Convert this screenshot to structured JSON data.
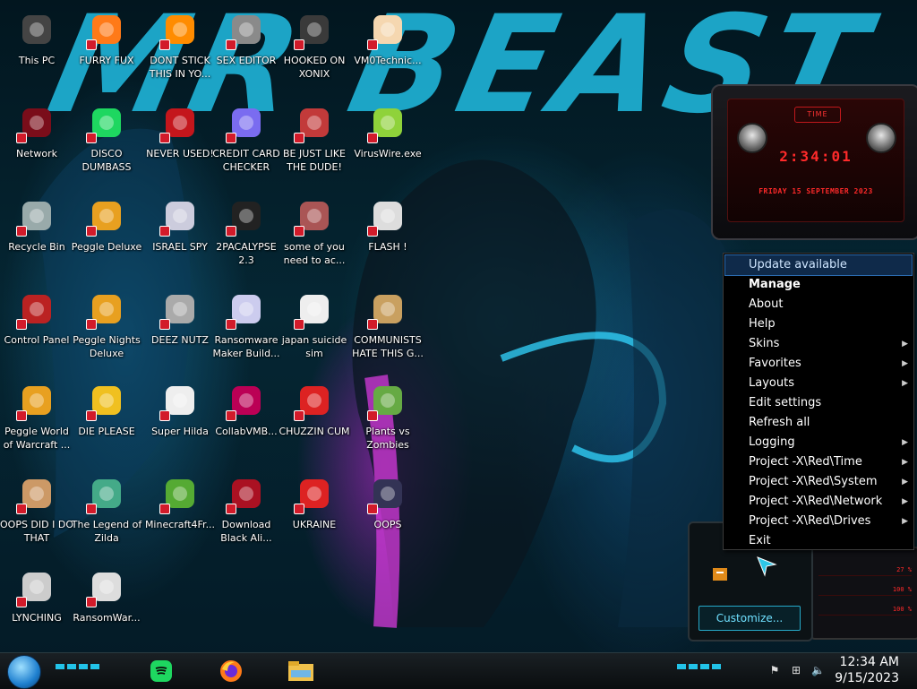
{
  "wallpaper": {
    "title": "MR BEAST"
  },
  "desktop": {
    "icons": [
      {
        "label": "This PC",
        "icon": "this-pc-icon"
      },
      {
        "label": "FURRY FUX",
        "icon": "firefox-icon"
      },
      {
        "label": "DONT STICK THIS IN YO...",
        "icon": "vlc-cone-icon"
      },
      {
        "label": "SEX EDITOR",
        "icon": "hex-editor-icon"
      },
      {
        "label": "HOOKED ON XONIX",
        "icon": "xonix-game-icon"
      },
      {
        "label": "VM0Technic...",
        "icon": "doctor-avatar-icon"
      },
      {
        "label": "Network",
        "icon": "network-icon"
      },
      {
        "label": "DISCO DUMBASS",
        "icon": "spotify-icon"
      },
      {
        "label": "NEVER USED!",
        "icon": "dev-cpp-icon"
      },
      {
        "label": "CREDIT CARD CHECKER",
        "icon": "credit-card-icon"
      },
      {
        "label": "BE JUST LIKE THE DUDE!",
        "icon": "santa-icon"
      },
      {
        "label": "VirusWire.exe",
        "icon": "lime-icon"
      },
      {
        "label": "Recycle Bin",
        "icon": "recycle-bin-icon"
      },
      {
        "label": "Peggle Deluxe",
        "icon": "peggle-icon"
      },
      {
        "label": "ISRAEL SPY",
        "icon": "spy-app-icon"
      },
      {
        "label": "2PACALYPSE 2.3",
        "icon": "terminal-icon"
      },
      {
        "label": "some of you need to ac...",
        "icon": "beaver-icon"
      },
      {
        "label": "FLASH !",
        "icon": "flash-document-icon"
      },
      {
        "label": "Control Panel",
        "icon": "control-panel-icon"
      },
      {
        "label": "Peggle Nights Deluxe",
        "icon": "peggle-nights-icon"
      },
      {
        "label": "DEEZ NUTZ",
        "icon": "window-stack-icon"
      },
      {
        "label": "Ransomware Maker Build...",
        "icon": "program-window-icon"
      },
      {
        "label": "japan suicide sim",
        "icon": "document-chart-icon"
      },
      {
        "label": "COMMUNISTS HATE THIS G...",
        "icon": "money-bag-icon"
      },
      {
        "label": "Peggle World of Warcraft ...",
        "icon": "peggle-wow-icon"
      },
      {
        "label": "DIE PLEASE",
        "icon": "adobe-de-icon"
      },
      {
        "label": "Super Hilda",
        "icon": "pixel-game-icon"
      },
      {
        "label": "CollabVMB...",
        "icon": "collabvm-icon"
      },
      {
        "label": "CHUZZIN CUM",
        "icon": "chuzzle-icon"
      },
      {
        "label": "Plants vs Zombies",
        "icon": "plants-vs-zombies-icon"
      },
      {
        "label": "OOPS DID I DO THAT",
        "icon": "portrait-icon"
      },
      {
        "label": "The Legend of Zilda",
        "icon": "zelda-sprite-icon"
      },
      {
        "label": "Minecraft4Fr...",
        "icon": "minecraft-block-icon"
      },
      {
        "label": "Download Black Ali...",
        "icon": "alienware-orb-icon"
      },
      {
        "label": "UKRAINE",
        "icon": "radiation-icon"
      },
      {
        "label": "OOPS",
        "icon": "oops-icon"
      },
      {
        "label": "LYNCHING",
        "icon": "network-cube-icon"
      },
      {
        "label": "RansomWar...",
        "icon": "skull-icon"
      }
    ]
  },
  "widgets": {
    "clock": {
      "title": "TIME",
      "time": "2:34:01",
      "date": "FRIDAY 15 SEPTEMBER 2023"
    },
    "drives": {
      "values": [
        "27 %",
        "100 %",
        "100 %"
      ]
    },
    "customize": {
      "label": "Customize..."
    }
  },
  "context_menu": {
    "items": [
      {
        "label": "Update available",
        "submenu": false,
        "highlight": true,
        "bold": false
      },
      {
        "label": "Manage",
        "submenu": false,
        "highlight": false,
        "bold": true
      },
      {
        "label": "About",
        "submenu": false,
        "highlight": false,
        "bold": false
      },
      {
        "label": "Help",
        "submenu": false,
        "highlight": false,
        "bold": false
      },
      {
        "label": "Skins",
        "submenu": true,
        "highlight": false,
        "bold": false
      },
      {
        "label": "Favorites",
        "submenu": true,
        "highlight": false,
        "bold": false
      },
      {
        "label": "Layouts",
        "submenu": true,
        "highlight": false,
        "bold": false
      },
      {
        "label": "Edit settings",
        "submenu": false,
        "highlight": false,
        "bold": false
      },
      {
        "label": "Refresh all",
        "submenu": false,
        "highlight": false,
        "bold": false
      },
      {
        "label": "Logging",
        "submenu": true,
        "highlight": false,
        "bold": false
      },
      {
        "label": "Project -X\\Red\\Time",
        "submenu": true,
        "highlight": false,
        "bold": false
      },
      {
        "label": "Project -X\\Red\\System",
        "submenu": true,
        "highlight": false,
        "bold": false
      },
      {
        "label": "Project -X\\Red\\Network",
        "submenu": true,
        "highlight": false,
        "bold": false
      },
      {
        "label": "Project -X\\Red\\Drives",
        "submenu": true,
        "highlight": false,
        "bold": false
      },
      {
        "label": "Exit",
        "submenu": false,
        "highlight": false,
        "bold": false
      }
    ]
  },
  "taskbar": {
    "apps": [
      {
        "icon": "spotify-icon"
      },
      {
        "icon": "firefox-icon"
      },
      {
        "icon": "file-explorer-icon"
      }
    ],
    "tray": [
      {
        "icon": "flag-icon"
      },
      {
        "icon": "network-tray-icon"
      },
      {
        "icon": "volume-icon"
      }
    ],
    "clock": {
      "time": "12:34 AM",
      "date": "9/15/2023"
    }
  },
  "colors": {
    "accent": "#1fb4d8",
    "widget_red": "#ff2a2a",
    "menu_highlight": "#0f2a4a"
  }
}
